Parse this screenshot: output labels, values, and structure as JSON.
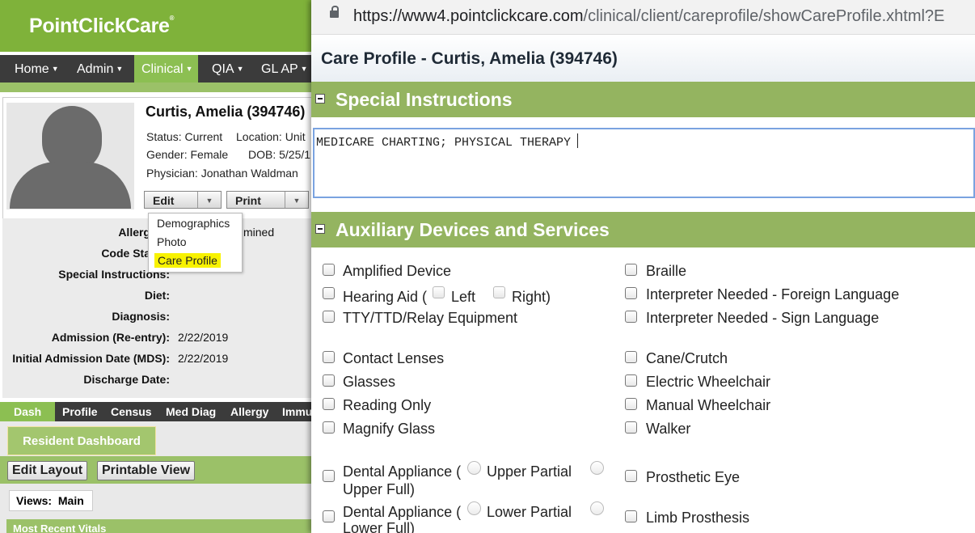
{
  "brand": {
    "name": "PointClickCare",
    "mark": "®"
  },
  "nav": [
    {
      "label": "Home"
    },
    {
      "label": "Admin"
    },
    {
      "label": "Clinical"
    },
    {
      "label": "QIA"
    },
    {
      "label": "GL AP"
    }
  ],
  "patient": {
    "name": "Curtis, Amelia (394746)",
    "status": "Status: Current",
    "location": "Location: Unit",
    "gender": "Gender: Female",
    "dob": "DOB: 5/25/1",
    "physician": "Physician: Jonathan Waldman"
  },
  "actions": {
    "edit": "Edit",
    "print": "Print"
  },
  "edit_menu": [
    "Demographics",
    "Photo",
    "Care Profile"
  ],
  "details": [
    {
      "label": "Allerg",
      "value": "mined"
    },
    {
      "label": "Code Sta",
      "value": ""
    },
    {
      "label": "Special Instructions:",
      "value": ""
    },
    {
      "label": "Diet:",
      "value": ""
    },
    {
      "label": "Diagnosis:",
      "value": ""
    },
    {
      "label": "Admission (Re-entry):",
      "value": "2/22/2019"
    },
    {
      "label": "Initial Admission Date (MDS):",
      "value": "2/22/2019"
    },
    {
      "label": "Discharge Date:",
      "value": ""
    }
  ],
  "tabs": [
    "Dash",
    "Profile",
    "Census",
    "Med Diag",
    "Allergy",
    "Immu"
  ],
  "dashboard": {
    "tab": "Resident Dashboard",
    "edit_layout": "Edit Layout",
    "printable_view": "Printable View",
    "views_label": "Views:",
    "views_value": "Main",
    "vitals": "Most Recent Vitals"
  },
  "popup": {
    "url_host": "https://www4.pointclickcare.com",
    "url_path": "/clinical/client/careprofile/showCareProfile.xhtml?E",
    "title": "Care Profile - Curtis, Amelia (394746)",
    "special_section": "Special Instructions",
    "special_text": "MEDICARE CHARTING; PHYSICAL THERAPY",
    "aux_section": "Auxiliary Devices and Services",
    "left_items": {
      "amplified": "Amplified Device",
      "hearing": "Hearing Aid (",
      "left": "Left",
      "right": "Right)",
      "tty": "TTY/TTD/Relay Equipment",
      "contact": "Contact Lenses",
      "glasses": "Glasses",
      "reading": "Reading Only",
      "magnify": "Magnify Glass",
      "dental1": "Dental Appliance (",
      "upper_partial": "Upper Partial",
      "upper_full": "Upper Full)",
      "dental2": "Dental Appliance (",
      "lower_partial": "Lower Partial",
      "lower_full": "Lower Full)"
    },
    "right_items": {
      "braille": "Braille",
      "interp_foreign": "Interpreter Needed - Foreign Language",
      "interp_sign": "Interpreter Needed - Sign Language",
      "cane": "Cane/Crutch",
      "electric": "Electric Wheelchair",
      "manual": "Manual Wheelchair",
      "walker": "Walker",
      "prosthetic_eye": "Prosthetic Eye",
      "limb": "Limb Prosthesis"
    }
  }
}
